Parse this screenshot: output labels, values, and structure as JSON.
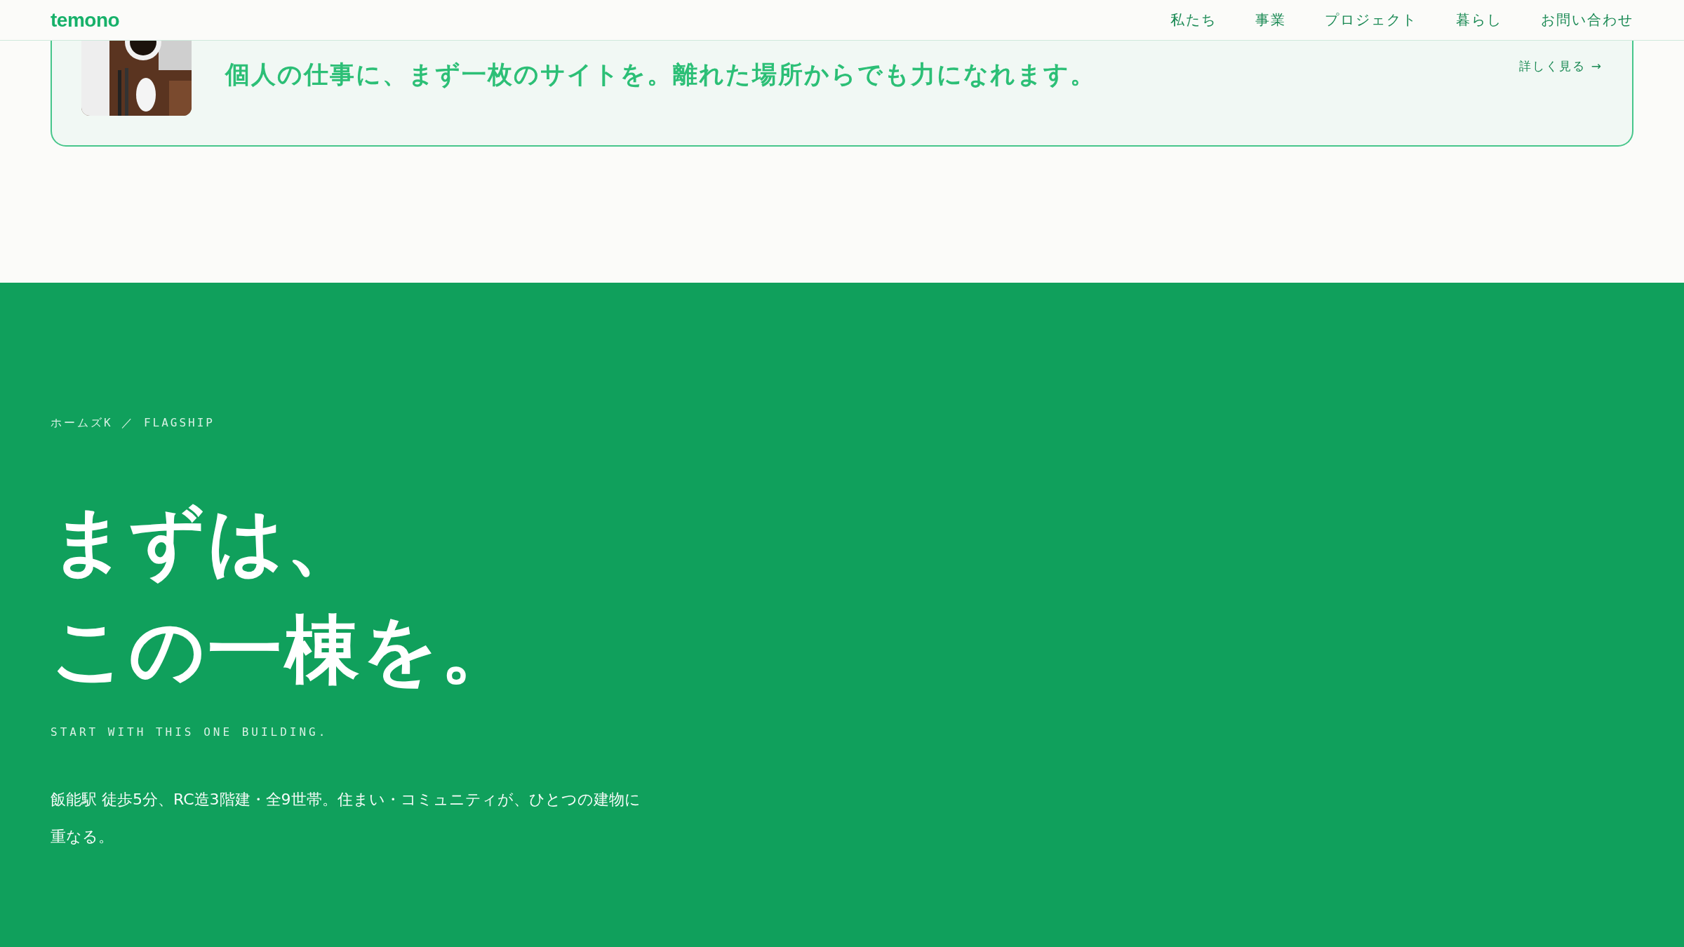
{
  "header": {
    "logo": "temono",
    "nav": [
      {
        "label": "私たち"
      },
      {
        "label": "事業"
      },
      {
        "label": "プロジェクト"
      },
      {
        "label": "暮らし"
      },
      {
        "label": "お問い合わせ"
      }
    ]
  },
  "card": {
    "title": "個人の仕事に、まず一枚のサイトを。離れた場所からでも力になれます。",
    "link": "詳しく見る →"
  },
  "hero": {
    "breadcrumb": "ホームズK ／ FLAGSHIP",
    "headline": [
      "まずは、",
      "この一棟を。"
    ],
    "subtitle": "START WITH THIS ONE BUILDING.",
    "body": "飯能駅 徒歩5分、RC造3階建・全9世帯。住まい・コミュニティが、ひとつの建物に重なる。"
  }
}
